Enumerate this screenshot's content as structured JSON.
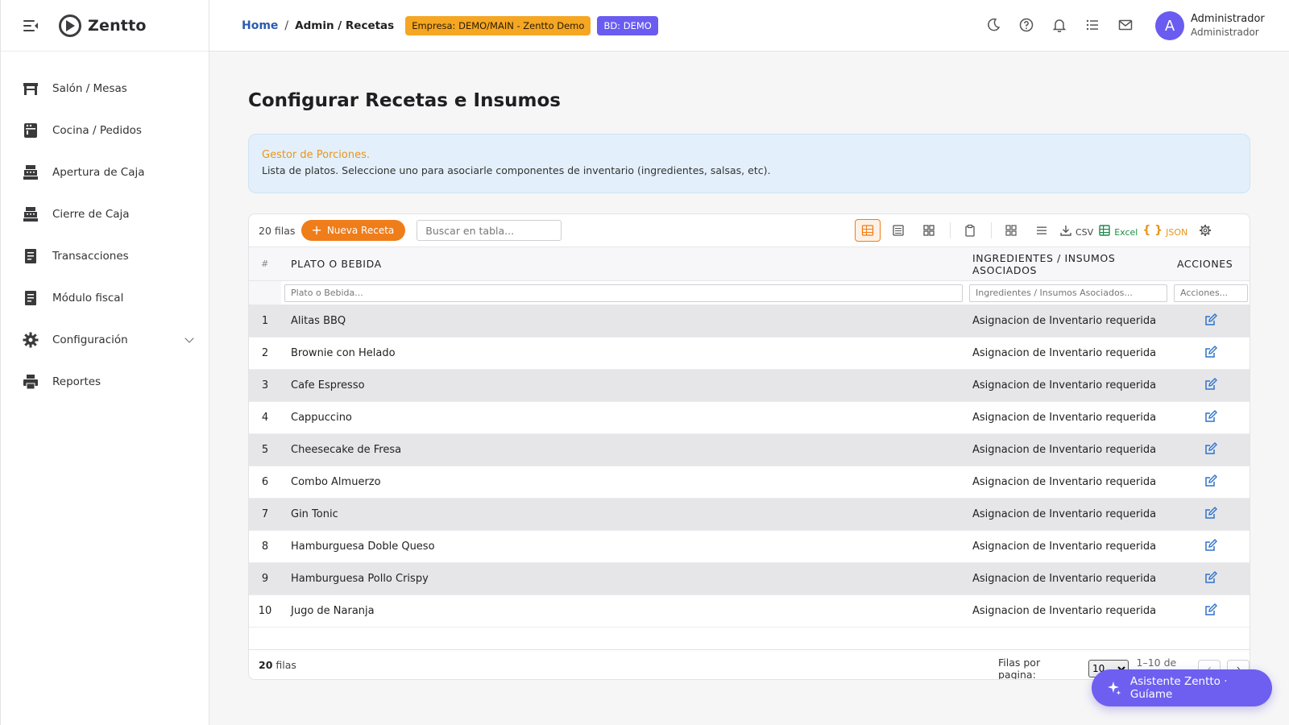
{
  "brand": {
    "name": "Zentto"
  },
  "sidebar": {
    "items": [
      {
        "label": "Salón / Mesas",
        "icon": "table-icon"
      },
      {
        "label": "Cocina / Pedidos",
        "icon": "kitchen-icon"
      },
      {
        "label": "Apertura de Caja",
        "icon": "cash-register-icon"
      },
      {
        "label": "Cierre de Caja",
        "icon": "cash-register-icon"
      },
      {
        "label": "Transacciones",
        "icon": "receipt-icon"
      },
      {
        "label": "Módulo fiscal",
        "icon": "receipt-icon"
      },
      {
        "label": "Configuración",
        "icon": "gear-icon"
      },
      {
        "label": "Reportes",
        "icon": "printer-icon"
      }
    ]
  },
  "header": {
    "breadcrumb_home": "Home",
    "breadcrumb_sep": "/",
    "breadcrumb_current": "Admin / Recetas",
    "empresa_badge": "Empresa: DEMO/MAIN - Zentto Demo",
    "bd_badge": "BD: DEMO",
    "avatar_letter": "A",
    "user_name": "Administrador",
    "user_role": "Administrador"
  },
  "page": {
    "title": "Configurar Recetas e Insumos",
    "info_title": "Gestor de Porciones.",
    "info_text": "Lista de platos. Seleccione uno para asociarle componentes de inventario (ingredientes, salsas, etc)."
  },
  "toolbar": {
    "rows_count": "20 filas",
    "new_button": "Nueva Receta",
    "search_placeholder": "Buscar en tabla...",
    "csv_label": "CSV",
    "excel_label": "Excel",
    "json_label": "JSON"
  },
  "table": {
    "columns": {
      "idx": "#",
      "name": "PLATO O BEBIDA",
      "ingredients": "INGREDIENTES / INSUMOS ASOCIADOS",
      "actions": "ACCIONES"
    },
    "filters": {
      "name": "Plato o Bebida...",
      "ingredients": "Ingredientes / Insumos Asociados...",
      "actions": "Acciones..."
    },
    "rows": [
      {
        "idx": "1",
        "name": "Alitas BBQ",
        "ingredients": "Asignacion de Inventario requerida"
      },
      {
        "idx": "2",
        "name": "Brownie con Helado",
        "ingredients": "Asignacion de Inventario requerida"
      },
      {
        "idx": "3",
        "name": "Cafe Espresso",
        "ingredients": "Asignacion de Inventario requerida"
      },
      {
        "idx": "4",
        "name": "Cappuccino",
        "ingredients": "Asignacion de Inventario requerida"
      },
      {
        "idx": "5",
        "name": "Cheesecake de Fresa",
        "ingredients": "Asignacion de Inventario requerida"
      },
      {
        "idx": "6",
        "name": "Combo Almuerzo",
        "ingredients": "Asignacion de Inventario requerida"
      },
      {
        "idx": "7",
        "name": "Gin Tonic",
        "ingredients": "Asignacion de Inventario requerida"
      },
      {
        "idx": "8",
        "name": "Hamburguesa Doble Queso",
        "ingredients": "Asignacion de Inventario requerida"
      },
      {
        "idx": "9",
        "name": "Hamburguesa Pollo Crispy",
        "ingredients": "Asignacion de Inventario requerida"
      },
      {
        "idx": "10",
        "name": "Jugo de Naranja",
        "ingredients": "Asignacion de Inventario requerida"
      }
    ]
  },
  "footer": {
    "count_num": "20",
    "count_label": "filas",
    "rows_per_page_label": "Filas por pagina:",
    "rows_per_page_value": "10",
    "range": "1–10 de 20",
    "prev": "‹",
    "next": "›"
  },
  "assistant": {
    "label": "Asistente Zentto · Guíame"
  },
  "colors": {
    "accent_orange": "#ef7d1a",
    "accent_purple": "#6a5cf0",
    "link_blue": "#2a5db0",
    "edit_blue": "#2f72c9"
  }
}
